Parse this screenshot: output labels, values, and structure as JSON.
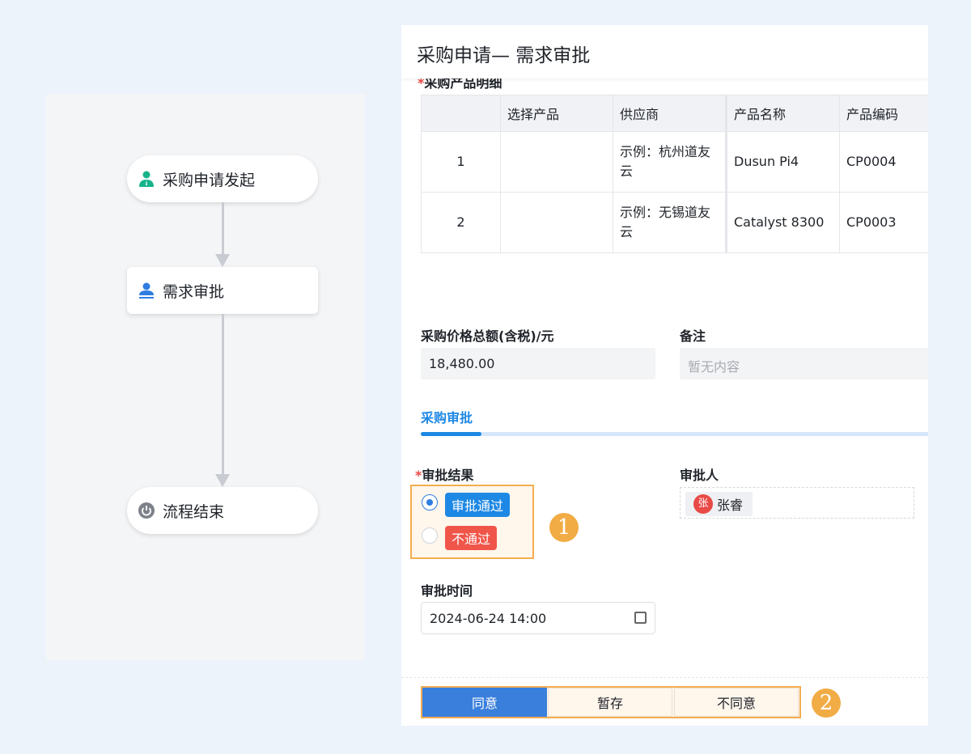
{
  "flow": {
    "nodes": [
      {
        "label": "采购申请发起",
        "icon": "user-icon"
      },
      {
        "label": "需求审批",
        "icon": "approver-icon"
      },
      {
        "label": "流程结束",
        "icon": "power-icon"
      }
    ]
  },
  "form": {
    "title": "采购申请— 需求审批",
    "section_label": "采购产品明细",
    "table": {
      "headers": [
        "",
        "选择产品",
        "供应商",
        "产品名称",
        "产品编码"
      ],
      "rows": [
        [
          "1",
          "",
          "示例：杭州道友云",
          "Dusun Pi4",
          "CP0004"
        ],
        [
          "2",
          "",
          "示例：无锡道友云",
          "Catalyst 8300",
          "CP0003"
        ]
      ]
    },
    "total_label": "采购价格总额(含税)/元",
    "total_value": "18,480.00",
    "remark_label": "备注",
    "remark_placeholder": "暂无内容",
    "tab": "采购审批",
    "result_label": "审批结果",
    "options": [
      "审批通过",
      "不通过"
    ],
    "selected": 0,
    "approver_label": "审批人",
    "approver_avatar": "张",
    "approver_name": "张睿",
    "time_label": "审批时间",
    "time_value": "2024-06-24 14:00",
    "buttons": [
      "同意",
      "暂存",
      "不同意"
    ],
    "badges": [
      "1",
      "2"
    ]
  },
  "colors": {
    "primary": "#1e88e5",
    "danger": "#f0554a",
    "highlight": "#f5ad4f"
  }
}
